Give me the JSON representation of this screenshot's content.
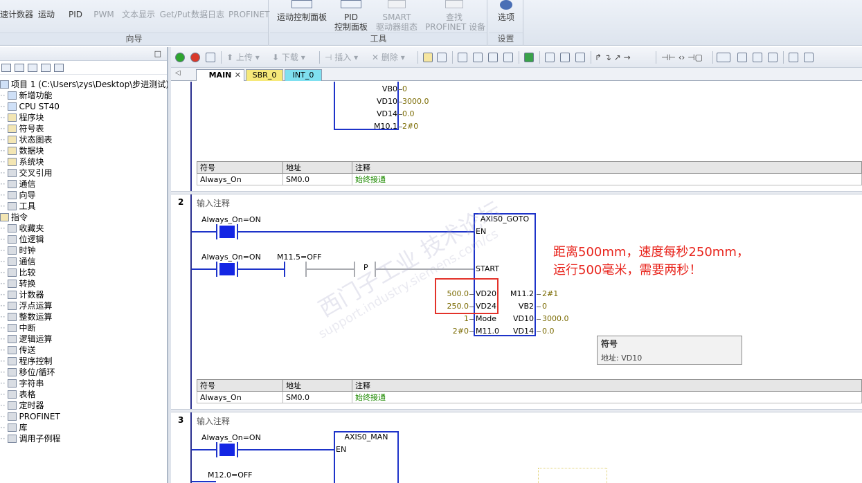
{
  "ribbon": {
    "groups": [
      {
        "title": "向导",
        "buttons": [
          "高速计数器",
          "运动",
          "PID",
          "PWM",
          "文本显示",
          "Get/Put",
          "数据日志",
          "PROFINET"
        ]
      },
      {
        "title": "工具",
        "buttons": [
          "运动控制面板",
          "PID 控制面板",
          "SMART 驱动器组态",
          "查找 PROFINET 设备"
        ]
      },
      {
        "title": "设置",
        "buttons": [
          "选项"
        ]
      }
    ],
    "b0": "速计数器",
    "b1": "运动",
    "b2": "PID",
    "b3": "PWM",
    "b4": "文本显示",
    "b5": "Get/Put",
    "b6": "数据日志",
    "b7": "PROFINET",
    "t0": "运动控制面板",
    "t1a": "PID",
    "t1b": "控制面板",
    "t2a": "SMART",
    "t2b": "驱动器组态",
    "t3a": "查找",
    "t3b": "PROFINET 设备",
    "s0": "选项",
    "g0": "向导",
    "g1": "工具",
    "g2": "设置"
  },
  "tree": {
    "project": "项目 1 (C:\\Users\\zys\\Desktop\\步进测试)",
    "items": [
      "新增功能",
      "CPU ST40",
      "程序块",
      "符号表",
      "状态图表",
      "数据块",
      "系统块",
      "交叉引用",
      "通信",
      "向导",
      "工具"
    ],
    "instructions": "指令",
    "inst_items": [
      "收藏夹",
      "位逻辑",
      "时钟",
      "通信",
      "比较",
      "转换",
      "计数器",
      "浮点运算",
      "整数运算",
      "中断",
      "逻辑运算",
      "传送",
      "程序控制",
      "移位/循环",
      "字符串",
      "表格",
      "定时器",
      "PROFINET",
      "库",
      "调用子例程"
    ]
  },
  "toolbar": {
    "upload": "上传",
    "download": "下载",
    "insert": "插入",
    "delete": "删除"
  },
  "tabs": {
    "main": "MAIN",
    "sbr": "SBR_0",
    "int": "INT_0"
  },
  "net1": {
    "rows": [
      {
        "pin": "VB0",
        "val": "0"
      },
      {
        "pin": "VD10",
        "val": "3000.0"
      },
      {
        "pin": "VD14",
        "val": "0.0"
      },
      {
        "pin": "M10.1",
        "val": "2#0"
      }
    ],
    "sym_headers": [
      "符号",
      "地址",
      "注释"
    ],
    "sym_row": [
      "Always_On",
      "SM0.0",
      "始终接通"
    ]
  },
  "net2": {
    "num": "2",
    "comment": "输入注释",
    "c1": "Always_On=ON",
    "c2": "Always_On=ON",
    "c3": "M11.5=OFF",
    "p": "P",
    "box_title": "AXIS0_GOTO",
    "en": "EN",
    "start": "START",
    "in_vals": [
      "500.0",
      "250.0",
      "1",
      "2#0"
    ],
    "in_pins": [
      "VD20",
      "VD24",
      "Mode",
      "M11.0"
    ],
    "out_pins": [
      "M11.2",
      "VB2",
      "VD10",
      "VD14"
    ],
    "out_vals": [
      "2#1",
      "0",
      "3000.0",
      "0.0"
    ],
    "sym_headers": [
      "符号",
      "地址",
      "注释"
    ],
    "sym_row": [
      "Always_On",
      "SM0.0",
      "始终接通"
    ]
  },
  "net3": {
    "num": "3",
    "comment": "输入注释",
    "c1": "Always_On=ON",
    "c2": "M12.0=OFF",
    "box_title": "AXIS0_MAN",
    "en": "EN"
  },
  "annotation": {
    "line1": "距离500mm，速度每秒250mm，",
    "line2": "运行500毫米，需要两秒！"
  },
  "tooltip": {
    "title": "符号",
    "detail": "地址: VD10"
  },
  "watermark": {
    "text1": "西门子工业 技术论坛",
    "text2": "support.industry.siemens.com/cs"
  },
  "colors": {
    "wire": "#1d33c9",
    "note": "#e8251d",
    "highlight": "#e3322a",
    "on": "#2a8a00"
  }
}
